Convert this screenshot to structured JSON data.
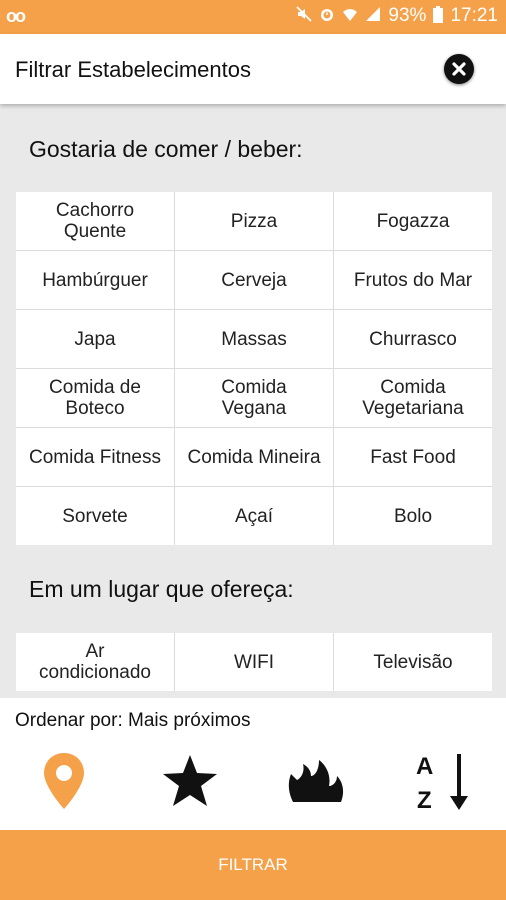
{
  "status_bar": {
    "left_icon": "voicemail-icon",
    "battery": "93%",
    "time": "17:21",
    "icons": [
      "mute-icon",
      "alarm-icon",
      "wifi-icon",
      "signal-icon",
      "battery-icon"
    ]
  },
  "header": {
    "title": "Filtrar Estabelecimentos",
    "close_icon": "close-icon"
  },
  "food_section": {
    "title": "Gostaria de comer / beber:",
    "items": [
      {
        "label": "Cachorro\nQuente"
      },
      {
        "label": "Pizza"
      },
      {
        "label": "Fogazza"
      },
      {
        "label": "Hambúrguer"
      },
      {
        "label": "Cerveja"
      },
      {
        "label": "Frutos do Mar"
      },
      {
        "label": "Japa"
      },
      {
        "label": "Massas"
      },
      {
        "label": "Churrasco"
      },
      {
        "label": "Comida de\nBoteco"
      },
      {
        "label": "Comida\nVegana"
      },
      {
        "label": "Comida\nVegetariana"
      },
      {
        "label": "Comida Fitness"
      },
      {
        "label": "Comida Mineira"
      },
      {
        "label": "Fast Food"
      },
      {
        "label": "Sorvete"
      },
      {
        "label": "Açaí"
      },
      {
        "label": "Bolo"
      }
    ]
  },
  "amenities_section": {
    "title": "Em um lugar que ofereça:",
    "items": [
      {
        "label": "Ar\ncondicionado"
      },
      {
        "label": "WIFI"
      },
      {
        "label": "Televisão"
      }
    ]
  },
  "sort": {
    "label": "Ordenar por: Mais próximos",
    "options": [
      {
        "icon": "location-pin-icon",
        "selected": true
      },
      {
        "icon": "star-icon",
        "selected": false
      },
      {
        "icon": "flame-icon",
        "selected": false
      },
      {
        "icon": "sort-az-icon",
        "selected": false
      }
    ]
  },
  "filter_button": {
    "label": "FILTRAR"
  },
  "colors": {
    "accent": "#f5a14a",
    "background": "#e9e9e9"
  }
}
